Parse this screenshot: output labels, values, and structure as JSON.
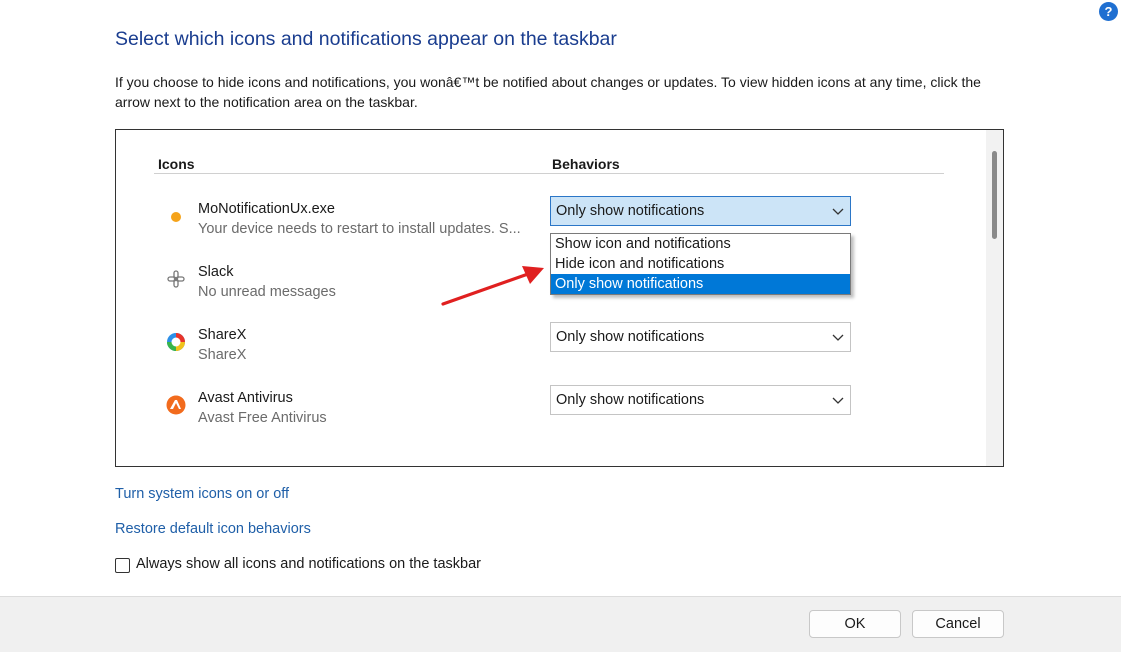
{
  "help": {
    "icon": "help-question-icon",
    "glyph": "?"
  },
  "title": "Select which icons and notifications appear on the taskbar",
  "description": "If you choose to hide icons and notifications, you wonâ€™t be notified about changes or updates. To view hidden icons at any time, click the arrow next to the notification area on the taskbar.",
  "table": {
    "icons_header": "Icons",
    "behaviors_header": "Behaviors",
    "rows": [
      {
        "icon": "orange-dot-icon",
        "name": "MoNotificationUx.exe",
        "desc": "Your device needs to restart to install updates. S...",
        "behavior": "Only show notifications"
      },
      {
        "icon": "slack-icon",
        "name": "Slack",
        "desc": "No unread messages",
        "behavior": "Only show notifications"
      },
      {
        "icon": "sharex-icon",
        "name": "ShareX",
        "desc": "ShareX",
        "behavior": "Only show notifications"
      },
      {
        "icon": "avast-icon",
        "name": "Avast Antivirus",
        "desc": "Avast Free Antivirus",
        "behavior": "Only show notifications"
      }
    ]
  },
  "dropdown": {
    "options": [
      "Show icon and notifications",
      "Hide icon and notifications",
      "Only show notifications"
    ],
    "selected_index": 2
  },
  "links": {
    "system_icons": "Turn system icons on or off",
    "restore_defaults": "Restore default icon behaviors"
  },
  "checkbox": {
    "label": "Always show all icons and notifications on the taskbar",
    "checked": false
  },
  "buttons": {
    "ok": "OK",
    "cancel": "Cancel"
  },
  "colors": {
    "accent": "#0078d7",
    "title": "#1a3d8f",
    "link": "#1f5fa8",
    "annotation_arrow": "#e02020"
  }
}
